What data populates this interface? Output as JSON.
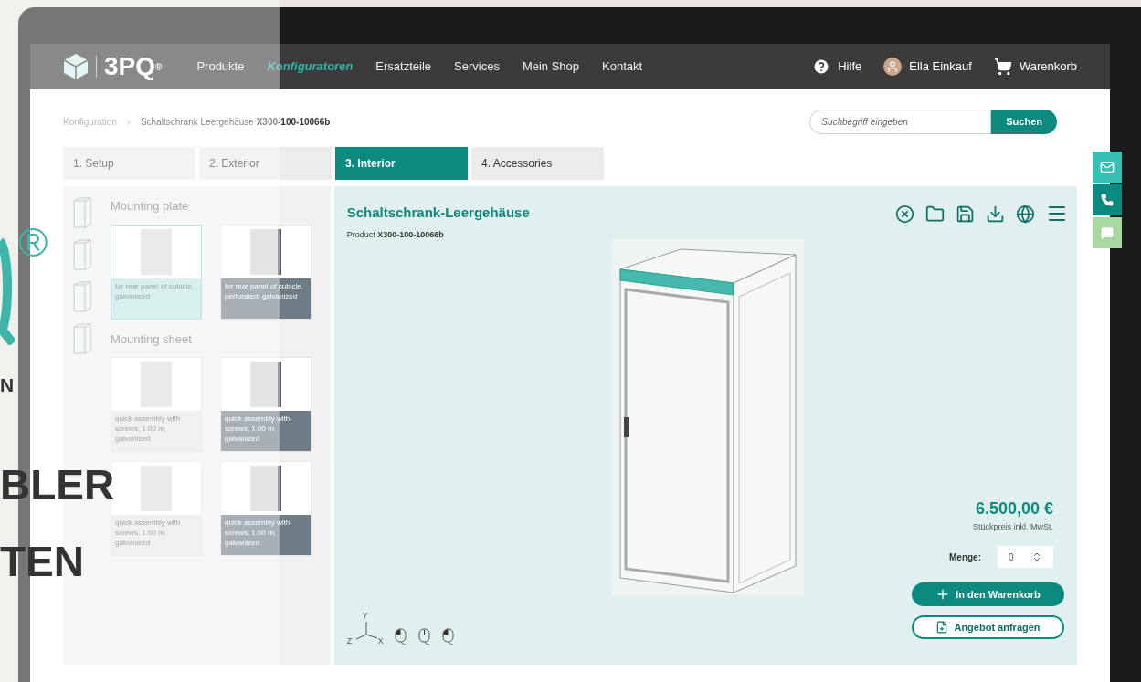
{
  "logo": {
    "text": "3PQ",
    "mark": "®"
  },
  "nav": [
    {
      "label": "Produkte",
      "selected": false
    },
    {
      "label": "Konfiguratoren",
      "selected": true
    },
    {
      "label": "Ersatzteile",
      "selected": false
    },
    {
      "label": "Services",
      "selected": false
    },
    {
      "label": "Mein Shop",
      "selected": false
    },
    {
      "label": "Kontakt",
      "selected": false
    }
  ],
  "nav_right": {
    "help": "Hilfe",
    "user": "Ella Einkauf",
    "cart": "Warenkorb"
  },
  "breadcrumb": [
    "Konfiguration",
    "Schaltschrank Leergehäuse **X300-100-10066b**"
  ],
  "search": {
    "placeholder": "Suchbegriff eingeben",
    "button": "Suchen"
  },
  "steps": [
    {
      "label": "1. Setup",
      "selected": false
    },
    {
      "label": "2. Exterior",
      "selected": false
    },
    {
      "label": "3. Interior",
      "selected": true
    },
    {
      "label": "4. Accessories",
      "selected": false
    }
  ],
  "sidebar": {
    "groups": [
      {
        "title": "Mounting plate",
        "items": [
          {
            "caption": "for rear panel of cubicle, galvanized",
            "selected": true,
            "highlighted": false
          },
          {
            "caption": "for rear panel of cubicle, perforated, galvanized",
            "selected": false,
            "highlighted": true
          }
        ]
      },
      {
        "title": "Mounting sheet",
        "items": [
          {
            "caption": "quick assembly with screws, 1.00 m, galvanized",
            "selected": false,
            "highlighted": false
          },
          {
            "caption": "quick assembly with screws, 1.00 m, galvanized",
            "selected": false,
            "highlighted": true
          },
          {
            "caption": "quick assembly with screws, 1.00 m, galvanized",
            "selected": false,
            "highlighted": false
          },
          {
            "caption": "quick assembly with screws, 1.00 m, galvanized",
            "selected": false,
            "highlighted": true
          }
        ]
      }
    ]
  },
  "product": {
    "title": "Schaltschrank-Leergehäuse",
    "subtitle": "Product **X300-100-10066b**",
    "price": "6.500,00 €",
    "price_note": "Stückpreis inkl. MwSt.",
    "quantity_label": "Menge:",
    "quantity": "0",
    "add_button": "In den Warenkorb",
    "quote_button": "Angebot anfragen"
  },
  "axis_labels": [
    "Y",
    "Z",
    "X"
  ],
  "overlay": {
    "registered": "®",
    "line1": "N",
    "line2": "BLER",
    "line3": "TEN"
  }
}
